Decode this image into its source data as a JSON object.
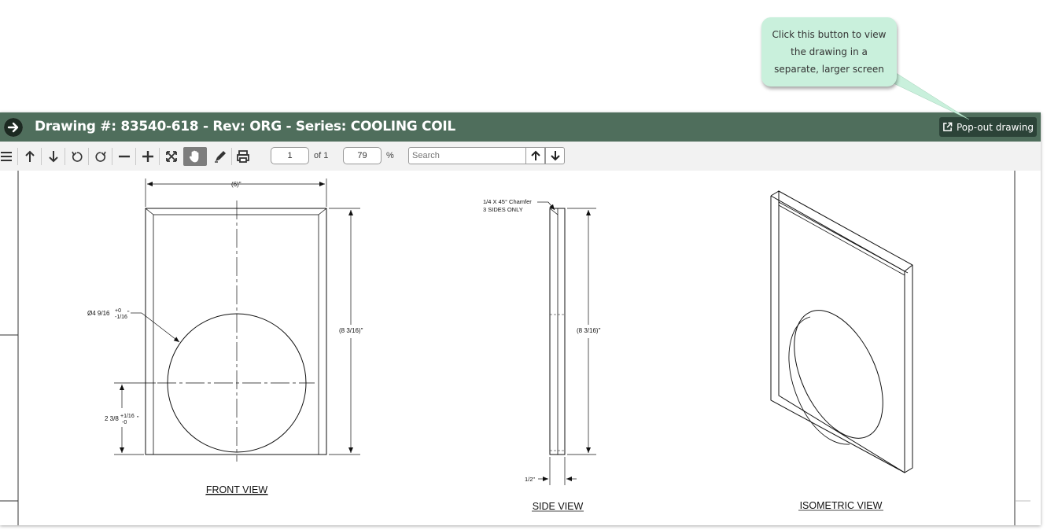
{
  "tooltip": {
    "text": "Click this button to view the drawing in a separate, larger screen"
  },
  "header": {
    "title": "Drawing #: 83540-618 - Rev: ORG - Series: COOLING COIL",
    "popout_label": "Pop-out drawing"
  },
  "toolbar": {
    "page_value": "1",
    "page_total": "of 1",
    "zoom_value": "79",
    "zoom_unit": "%",
    "search_placeholder": "Search",
    "icons": [
      "menu-icon",
      "page-up-icon",
      "page-down-icon",
      "rotate-ccw-icon",
      "rotate-cw-icon",
      "zoom-out-icon",
      "zoom-in-icon",
      "fit-icon",
      "pan-hand-icon",
      "annotate-icon",
      "print-icon"
    ]
  },
  "drawing": {
    "front_view_label": "FRONT VIEW",
    "side_view_label": "SIDE VIEW",
    "isometric_view_label": "ISOMETRIC VIEW",
    "width_dim": "(6)\"",
    "height_dim_front": "(8 3/16)\"",
    "height_dim_side": "(8 3/16)\"",
    "hole_dia": "Ø4 9/16",
    "hole_tol_plus": "+0",
    "hole_tol_minus": "-1/16",
    "hole_tol_unit": "\"",
    "center_dim": "2 3/8",
    "center_tol_plus": "+1/16",
    "center_tol_minus": "-0",
    "center_tol_unit": "\"",
    "chamfer_line1": "1/4 X 45° Chamfer",
    "chamfer_line2": "3 SIDES ONLY",
    "thickness_dim": "1/2\""
  },
  "colors": {
    "header_bg": "#4f6e5c",
    "popout_bg": "#2c4338",
    "tooltip_bg": "#c9f0dc",
    "toolbar_bg": "#f2f2f2"
  }
}
